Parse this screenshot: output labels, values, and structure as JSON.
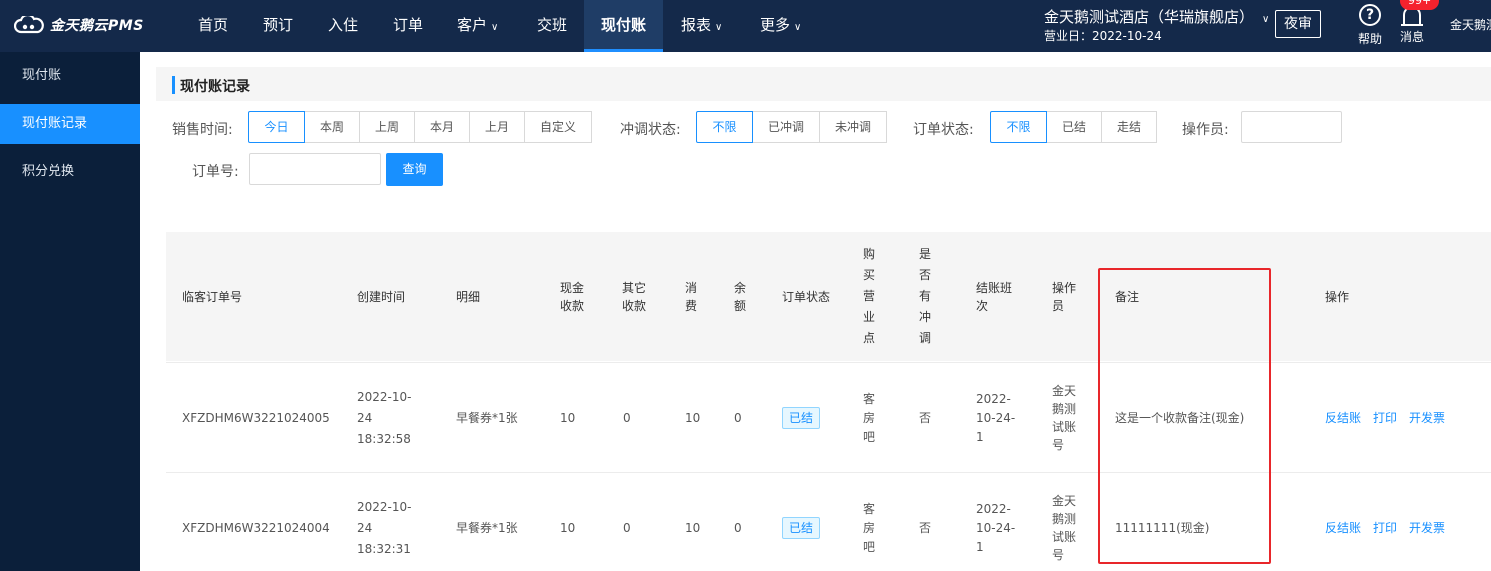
{
  "app": {
    "name": "金天鹅云PMS"
  },
  "nav": {
    "items": [
      {
        "label": "首页"
      },
      {
        "label": "预订"
      },
      {
        "label": "入住"
      },
      {
        "label": "订单"
      },
      {
        "label": "客户"
      },
      {
        "label": "交班"
      },
      {
        "label": "现付账"
      },
      {
        "label": "报表"
      },
      {
        "label": "更多"
      }
    ],
    "active": "现付账"
  },
  "hotel": {
    "name": "金天鹅测试酒店（华瑞旗舰店）",
    "business_date": "营业日：2022-10-24"
  },
  "header": {
    "night_audit": "夜审",
    "help_label": "帮助",
    "message_label": "消息",
    "message_badge": "99+",
    "user_name": "金天鹅测"
  },
  "sidebar": {
    "items": [
      {
        "label": "现付账"
      },
      {
        "label": "现付账记录"
      },
      {
        "label": "积分兑换"
      }
    ],
    "active": "现付账记录"
  },
  "page": {
    "title": "现付账记录"
  },
  "filters": {
    "sale_time": {
      "label": "销售时间:",
      "options": [
        "今日",
        "本周",
        "上周",
        "本月",
        "上月",
        "自定义"
      ],
      "selected": "今日"
    },
    "adjust_status": {
      "label": "冲调状态:",
      "options": [
        "不限",
        "已冲调",
        "未冲调"
      ],
      "selected": "不限"
    },
    "order_status": {
      "label": "订单状态:",
      "options": [
        "不限",
        "已结",
        "走结"
      ],
      "selected": "不限"
    },
    "operator": {
      "label": "操作员:",
      "value": ""
    },
    "order_no": {
      "label": "订单号:",
      "value": ""
    },
    "query_button": "查询"
  },
  "table": {
    "headers": {
      "order_no": "临客订单号",
      "created": "创建时间",
      "detail": "明细",
      "cash": "现金\n收款",
      "other": "其它\n收款",
      "consume": "消\n费",
      "balance": "余\n额",
      "status": "订单状态",
      "outlet": "购\n买\n营\n业\n点",
      "adjusted": "是\n否\n有\n冲\n调",
      "shift": "结账班\n次",
      "operator": "操作\n员",
      "remark": "备注",
      "actions": "操作"
    },
    "rows": [
      {
        "order_no": "XFZDHM6W3221024005",
        "created": "2022-10-\n24\n18:32:58",
        "detail": "早餐券*1张",
        "cash": "10",
        "other": "0",
        "consume": "10",
        "balance": "0",
        "status": "已结",
        "outlet": "客\n房\n吧",
        "adjusted": "否",
        "shift": "2022-\n10-24-\n1",
        "operator": "金天\n鹅测\n试账\n号",
        "remark": "这是一个收款备注(现金)",
        "actions": [
          "反结账",
          "打印",
          "开发票"
        ]
      },
      {
        "order_no": "XFZDHM6W3221024004",
        "created": "2022-10-\n24\n18:32:31",
        "detail": "早餐券*1张",
        "cash": "10",
        "other": "0",
        "consume": "10",
        "balance": "0",
        "status": "已结",
        "outlet": "客\n房\n吧",
        "adjusted": "否",
        "shift": "2022-\n10-24-\n1",
        "operator": "金天\n鹅测\n试账\n号",
        "remark": "11111111(现金)",
        "actions": [
          "反结账",
          "打印",
          "开发票"
        ]
      }
    ]
  },
  "colors": {
    "topbar": "#14294a",
    "sidebar": "#0b1f3a",
    "accent": "#1890ff",
    "highlight": "#e8262a"
  }
}
